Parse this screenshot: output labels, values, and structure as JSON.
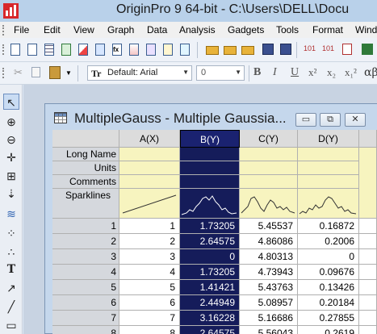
{
  "app": {
    "title": "OriginPro 9 64-bit - C:\\Users\\DELL\\Docu"
  },
  "menu": [
    "File",
    "Edit",
    "View",
    "Graph",
    "Data",
    "Analysis",
    "Gadgets",
    "Tools",
    "Format",
    "Wind"
  ],
  "format_toolbar": {
    "font": "Default: Arial",
    "font_icon": "Tr",
    "size": "0",
    "bold": "B",
    "italic": "I",
    "underline": "U",
    "superscript": "x²",
    "subscript": "x₂",
    "supersub": "x₁²"
  },
  "window": {
    "title": "MultipleGauss - Multiple Gaussia...",
    "buttons": {
      "minimize": "▭",
      "restore": "⧉",
      "close": "✕"
    }
  },
  "worksheet": {
    "columns": [
      "A(X)",
      "B(Y)",
      "C(Y)",
      "D(Y)"
    ],
    "meta_rows": [
      "Long Name",
      "Units",
      "Comments",
      "Sparklines"
    ],
    "rows": [
      {
        "n": "1",
        "a": "1",
        "b": "1.73205",
        "c": "5.45537",
        "d": "0.16872"
      },
      {
        "n": "2",
        "a": "2",
        "b": "2.64575",
        "c": "4.86086",
        "d": "0.2006"
      },
      {
        "n": "3",
        "a": "3",
        "b": "0",
        "c": "4.80313",
        "d": "0"
      },
      {
        "n": "4",
        "a": "4",
        "b": "1.73205",
        "c": "4.73943",
        "d": "0.09676"
      },
      {
        "n": "5",
        "a": "5",
        "b": "1.41421",
        "c": "5.43763",
        "d": "0.13426"
      },
      {
        "n": "6",
        "a": "6",
        "b": "2.44949",
        "c": "5.08957",
        "d": "0.20184"
      },
      {
        "n": "7",
        "a": "7",
        "b": "3.16228",
        "c": "5.16686",
        "d": "0.27855"
      },
      {
        "n": "8",
        "a": "8",
        "b": "2.64575",
        "c": "5.56043",
        "d": "0.2619"
      }
    ]
  },
  "selected_column_color": "#151c5a",
  "meta_row_color": "#f7f4bf"
}
